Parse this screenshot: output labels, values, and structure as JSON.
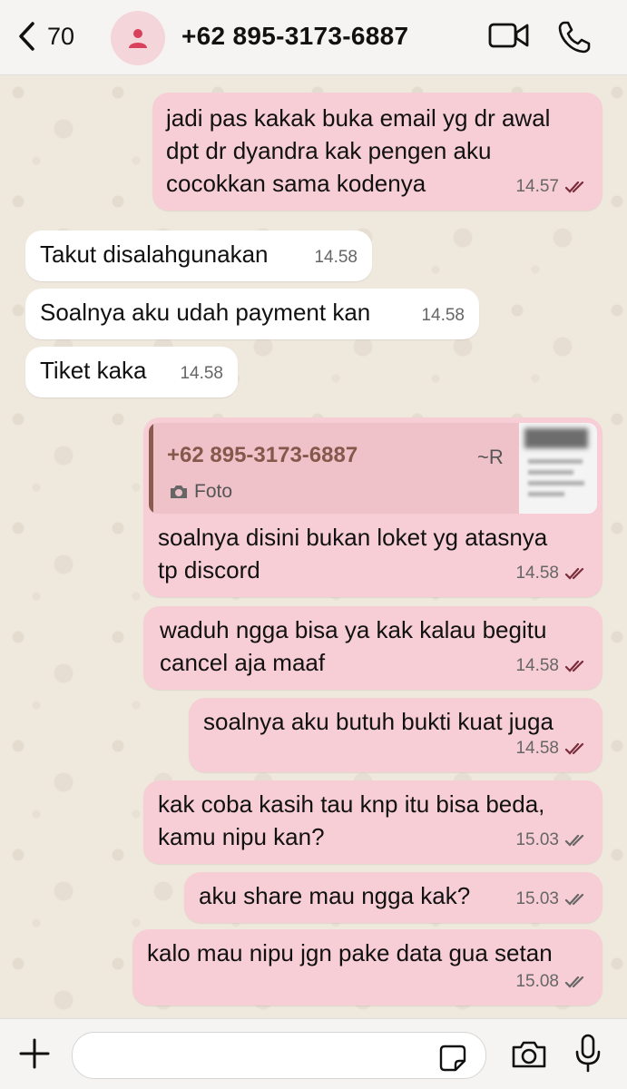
{
  "header": {
    "back_count": "70",
    "contact_name": "+62 895-3173-6887"
  },
  "colors": {
    "outgoing_bubble": "#f7ced5",
    "incoming_bubble": "#ffffff",
    "quote_name": "#86584b",
    "read_tick": "#7a2c3a"
  },
  "messages": [
    {
      "dir": "out",
      "text": "jadi pas kakak buka email yg dr awal\ndpt dr dyandra kak pengen aku\ncocokkan sama kodenya",
      "time": "14.57",
      "tick": "read"
    },
    {
      "dir": "in",
      "text": "Takut disalahgunakan",
      "time": "14.58"
    },
    {
      "dir": "in",
      "text": "Soalnya aku udah payment kan",
      "time": "14.58"
    },
    {
      "dir": "in",
      "text": "Tiket kaka",
      "time": "14.58"
    },
    {
      "dir": "out",
      "text": "soalnya disini bukan loket yg atasnya\ntp discord",
      "time": "14.58",
      "tick": "read",
      "quote": {
        "name": "+62 895-3173-6887",
        "tag": "~R",
        "type": "Foto"
      }
    },
    {
      "dir": "out",
      "text": "waduh ngga bisa ya kak kalau begitu\ncancel aja maaf",
      "time": "14.58",
      "tick": "read"
    },
    {
      "dir": "out",
      "text": "soalnya aku butuh bukti kuat juga",
      "time": "14.58",
      "tick": "read"
    },
    {
      "dir": "out",
      "text": "kak coba kasih tau knp itu bisa beda,\nkamu nipu kan?",
      "time": "15.03",
      "tick": "delivered"
    },
    {
      "dir": "out",
      "text": "aku share mau ngga kak?",
      "time": "15.03",
      "tick": "delivered"
    },
    {
      "dir": "out",
      "text": "kalo mau nipu jgn pake data gua setan",
      "time": "15.08",
      "tick": "delivered"
    }
  ],
  "icons": {
    "back": "chevron-left-icon",
    "avatar": "person-icon",
    "video": "video-camera-icon",
    "phone": "phone-icon",
    "plus": "plus-icon",
    "sticker": "sticker-icon",
    "camera": "camera-icon",
    "mic": "microphone-icon"
  }
}
